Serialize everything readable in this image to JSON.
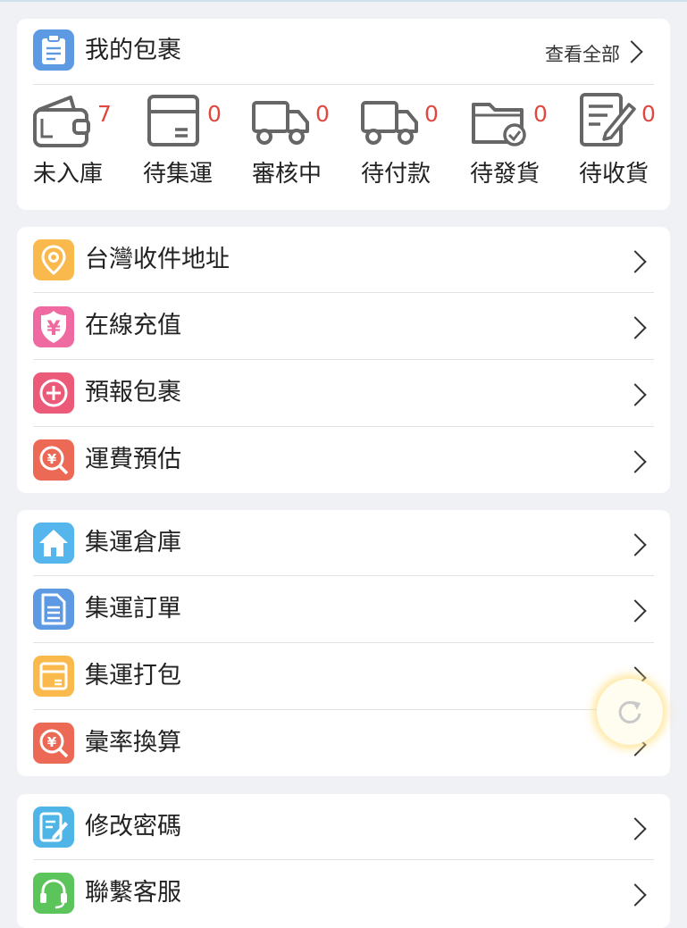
{
  "parcels": {
    "title": "我的包裹",
    "view_all": "查看全部",
    "statuses": [
      {
        "label": "未入庫",
        "count": "7",
        "icon": "wallet-icon"
      },
      {
        "label": "待集運",
        "count": "0",
        "icon": "box-icon"
      },
      {
        "label": "審核中",
        "count": "0",
        "icon": "truck-icon"
      },
      {
        "label": "待付款",
        "count": "0",
        "icon": "truck-icon"
      },
      {
        "label": "待發貨",
        "count": "0",
        "icon": "folder-check-icon"
      },
      {
        "label": "待收貨",
        "count": "0",
        "icon": "document-edit-icon"
      }
    ]
  },
  "menu_group_1": [
    {
      "label": "台灣收件地址",
      "icon": "location-pin-icon",
      "color": "#f9b94c"
    },
    {
      "label": "在線充值",
      "icon": "yen-shield-icon",
      "color": "#ef6aa0"
    },
    {
      "label": "預報包裹",
      "icon": "plus-circle-icon",
      "color": "#ec5a7a"
    },
    {
      "label": "運費預估",
      "icon": "yen-search-icon",
      "color": "#ec6a55"
    }
  ],
  "menu_group_2": [
    {
      "label": "集運倉庫",
      "icon": "home-icon",
      "color": "#54b6ec"
    },
    {
      "label": "集運訂單",
      "icon": "document-icon",
      "color": "#5d9ae3"
    },
    {
      "label": "集運打包",
      "icon": "package-icon",
      "color": "#f9b94c"
    },
    {
      "label": "彙率換算",
      "icon": "yen-search-icon",
      "color": "#ec6a55"
    }
  ],
  "menu_group_3": [
    {
      "label": "修改密碼",
      "icon": "edit-document-icon",
      "color": "#4fb5e6"
    },
    {
      "label": "聯繫客服",
      "icon": "headset-icon",
      "color": "#5bc45a"
    }
  ],
  "colors": {
    "accent_red": "#e0473f",
    "background": "#f0f1f5"
  }
}
